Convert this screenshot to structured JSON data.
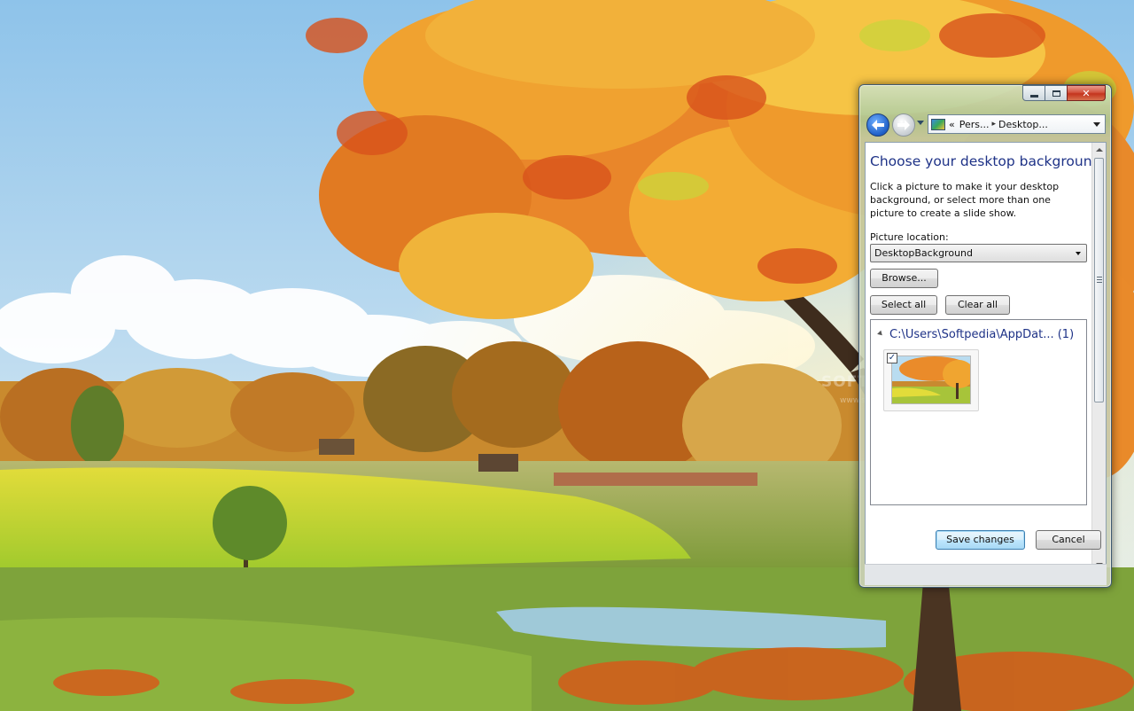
{
  "desktop": {
    "watermark": "SOFTPEDIA",
    "watermark_url": "www.softpedia.com"
  },
  "window": {
    "caption": {
      "minimize_icon": "minimize-icon",
      "maximize_icon": "maximize-icon",
      "close_icon": "close-x-icon",
      "close_glyph": "✕"
    },
    "nav": {
      "back_icon": "back-arrow-icon",
      "forward_icon": "forward-arrow-icon",
      "address_overflow": "«",
      "breadcrumb_1": "Pers...",
      "breadcrumb_sep": "▸",
      "breadcrumb_2": "Desktop..."
    },
    "heading": "Choose your desktop background",
    "description": "Click a picture to make it your desktop background, or select more than one picture to create a slide show.",
    "picture_location_label": "Picture location:",
    "picture_location_value": "DesktopBackground",
    "browse_label": "Browse...",
    "select_all_label": "Select all",
    "clear_all_label": "Clear all",
    "picture_group": {
      "title": "C:\\Users\\Softpedia\\AppDat... (1)",
      "thumbnail_checked": true,
      "check_glyph": "✓"
    },
    "save_label": "Save changes",
    "cancel_label": "Cancel"
  },
  "colors": {
    "heading": "#1e3287",
    "close_button": "#c4341e",
    "default_button": "#3c7fb1"
  }
}
